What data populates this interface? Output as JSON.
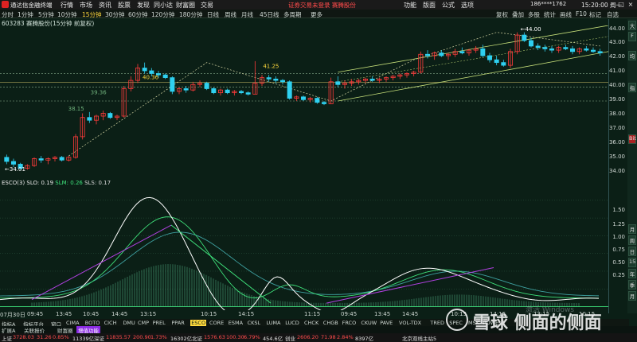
{
  "titlebar": {
    "app_name": "通达信金融终端",
    "menu": [
      "行情",
      "市场",
      "资讯",
      "股票",
      "发现",
      "同小达",
      "财富圈",
      "交易"
    ],
    "notice": "证券交易未登录  赛腾股份",
    "right_menu": [
      "功能",
      "版面",
      "公式",
      "选项"
    ],
    "account": "186****1762",
    "clock": "15:20:00 周一"
  },
  "periodbar": {
    "periods": [
      "分时",
      "1分钟",
      "5分钟",
      "10分钟",
      "15分钟",
      "30分钟",
      "60分钟",
      "120分钟",
      "180分钟",
      "日线",
      "周线",
      "月线",
      "45日线",
      "多周期",
      "更多"
    ],
    "active_period": "15分钟",
    "right_items": [
      "复权",
      "叠加",
      "多股",
      "统计",
      "画线",
      "F10",
      "标记",
      "自选"
    ]
  },
  "stock_label": "603283 赛腾股份(15分钟 前复权)",
  "indicator_label": {
    "main": "ESCO(3) SLO: 0.19",
    "slm": "SLM: 0.26",
    "sls": "SLS: 0.17"
  },
  "price_axis": [
    "44.00",
    "43.00",
    "42.00",
    "41.00",
    "40.00",
    "39.00",
    "38.00",
    "37.00",
    "36.00",
    "35.00",
    "34.00"
  ],
  "lower_axis": [
    "1.50",
    "1.25",
    "1.00",
    "0.75",
    "0.50",
    "0.25"
  ],
  "annotations": {
    "high": "44.00",
    "low": "34.01",
    "level1": "40.36",
    "level2": "41.25",
    "level3": "39.36",
    "level4": "38.15"
  },
  "time_axis": [
    "07月30日",
    "09:45",
    "13:45",
    "10:45",
    "14:45",
    "13:15",
    "10:15",
    "14:15",
    "11:15",
    "09:45",
    "13:45",
    "14:45",
    "10:15",
    "14:15",
    "13:15",
    "10:15"
  ],
  "indicator_tabs": [
    "指标A",
    "指标平台",
    "窗口",
    "CIMA",
    "BOTO",
    "CICH",
    "DMU",
    "CMP",
    "PREL",
    "PPAR",
    "ESCO",
    "CORE",
    "ESMA",
    "CKSL",
    "LUMA",
    "LUCD",
    "CHCK",
    "CHGB",
    "FRCO",
    "CKUW",
    "PAVE",
    "VOL-TDX",
    "TRED",
    "SPEC",
    "MSK",
    "POWE"
  ],
  "active_indicator": "ESCO",
  "sub_tabs": [
    "扩展A",
    "关联报价",
    "财富圈",
    "增值功能"
  ],
  "statusbar": {
    "sh_label": "上证",
    "sh_value": "3728.03",
    "sh_change": "31.26",
    "sh_pct": "0.85%",
    "sh_amount": "11339亿",
    "sz_label": "深证",
    "sz_value": "11835.57",
    "sz_change": "200.90",
    "sz_pct": "1.73%",
    "sz_amount": "16302亿",
    "bz_label": "北证",
    "bz_value": "1576.63",
    "bz_change": "100.30",
    "bz_pct": "6.79%",
    "bz_amount": "454.6亿",
    "cy_label": "创业",
    "cy_value": "2606.20",
    "cy_change": "71.98",
    "cy_pct": "2.84%",
    "cy_amount": "8397亿",
    "site": "北京双线主站5"
  },
  "watermark": {
    "text": "雪球 侧面的侧面",
    "faint": "激活 Windows"
  },
  "right_tools": [
    "大",
    "F",
    "均",
    "指",
    "Bit",
    "月",
    "周",
    "日",
    "15",
    "年",
    "季",
    "月"
  ],
  "colors": {
    "background": "#0b1f16",
    "up": "#ff3b3b",
    "down": "#2fd0f0",
    "accent": "#ffd93d",
    "ma_white": "#ffffff",
    "ma_green": "#3ee07a",
    "ma_purple": "#b040e0"
  },
  "chart_data": {
    "type": "candlestick",
    "ylim": [
      33.5,
      44.5
    ],
    "candles": [
      {
        "o": 34.9,
        "h": 35.1,
        "l": 34.4,
        "c": 34.6
      },
      {
        "o": 34.6,
        "h": 34.8,
        "l": 34.2,
        "c": 34.4
      },
      {
        "o": 34.4,
        "h": 34.5,
        "l": 34.0,
        "c": 34.1
      },
      {
        "o": 34.1,
        "h": 34.4,
        "l": 34.0,
        "c": 34.3
      },
      {
        "o": 34.3,
        "h": 34.9,
        "l": 34.2,
        "c": 34.8
      },
      {
        "o": 34.8,
        "h": 35.0,
        "l": 34.5,
        "c": 34.7
      },
      {
        "o": 34.7,
        "h": 34.9,
        "l": 34.4,
        "c": 34.8
      },
      {
        "o": 34.8,
        "h": 35.0,
        "l": 34.6,
        "c": 34.9
      },
      {
        "o": 34.9,
        "h": 35.0,
        "l": 34.6,
        "c": 34.7
      },
      {
        "o": 34.7,
        "h": 35.0,
        "l": 34.6,
        "c": 34.9
      },
      {
        "o": 34.9,
        "h": 36.6,
        "l": 34.8,
        "c": 36.4
      },
      {
        "o": 36.4,
        "h": 38.1,
        "l": 36.2,
        "c": 37.8
      },
      {
        "o": 37.8,
        "h": 38.2,
        "l": 37.4,
        "c": 37.6
      },
      {
        "o": 37.6,
        "h": 38.0,
        "l": 37.3,
        "c": 37.9
      },
      {
        "o": 37.9,
        "h": 38.3,
        "l": 37.6,
        "c": 38.1
      },
      {
        "o": 38.1,
        "h": 38.2,
        "l": 37.7,
        "c": 37.8
      },
      {
        "o": 37.8,
        "h": 38.0,
        "l": 37.6,
        "c": 37.9
      },
      {
        "o": 37.9,
        "h": 40.1,
        "l": 37.8,
        "c": 39.9
      },
      {
        "o": 39.9,
        "h": 40.8,
        "l": 39.7,
        "c": 40.5
      },
      {
        "o": 40.5,
        "h": 41.7,
        "l": 40.3,
        "c": 41.4
      },
      {
        "o": 41.4,
        "h": 41.8,
        "l": 41.0,
        "c": 41.2
      },
      {
        "o": 41.2,
        "h": 41.4,
        "l": 40.8,
        "c": 41.0
      },
      {
        "o": 41.0,
        "h": 41.2,
        "l": 40.7,
        "c": 40.9
      },
      {
        "o": 40.9,
        "h": 41.0,
        "l": 40.6,
        "c": 40.7
      },
      {
        "o": 40.7,
        "h": 40.8,
        "l": 39.5,
        "c": 39.7
      },
      {
        "o": 39.7,
        "h": 40.0,
        "l": 39.5,
        "c": 39.9
      },
      {
        "o": 39.9,
        "h": 40.1,
        "l": 39.6,
        "c": 39.8
      },
      {
        "o": 39.8,
        "h": 40.4,
        "l": 39.7,
        "c": 40.2
      },
      {
        "o": 40.2,
        "h": 40.5,
        "l": 40.0,
        "c": 40.3
      },
      {
        "o": 40.3,
        "h": 40.4,
        "l": 39.8,
        "c": 39.9
      },
      {
        "o": 39.9,
        "h": 40.0,
        "l": 39.5,
        "c": 39.6
      },
      {
        "o": 39.6,
        "h": 39.9,
        "l": 39.4,
        "c": 39.8
      },
      {
        "o": 39.8,
        "h": 39.9,
        "l": 39.5,
        "c": 39.6
      },
      {
        "o": 39.6,
        "h": 39.8,
        "l": 39.4,
        "c": 39.7
      },
      {
        "o": 39.7,
        "h": 39.8,
        "l": 39.5,
        "c": 39.6
      },
      {
        "o": 39.6,
        "h": 39.7,
        "l": 39.4,
        "c": 39.5
      },
      {
        "o": 39.5,
        "h": 41.9,
        "l": 39.5,
        "c": 40.3
      },
      {
        "o": 40.3,
        "h": 40.9,
        "l": 40.1,
        "c": 40.7
      },
      {
        "o": 40.7,
        "h": 40.9,
        "l": 40.4,
        "c": 40.6
      },
      {
        "o": 40.6,
        "h": 40.8,
        "l": 40.3,
        "c": 40.5
      },
      {
        "o": 40.5,
        "h": 40.6,
        "l": 40.2,
        "c": 40.4
      },
      {
        "o": 40.4,
        "h": 40.5,
        "l": 39.1,
        "c": 39.2
      },
      {
        "o": 39.2,
        "h": 39.4,
        "l": 39.0,
        "c": 39.3
      },
      {
        "o": 39.3,
        "h": 39.4,
        "l": 39.0,
        "c": 39.1
      },
      {
        "o": 39.1,
        "h": 39.3,
        "l": 38.9,
        "c": 39.2
      },
      {
        "o": 39.2,
        "h": 39.3,
        "l": 38.8,
        "c": 38.9
      },
      {
        "o": 38.9,
        "h": 39.0,
        "l": 38.7,
        "c": 38.8
      },
      {
        "o": 38.8,
        "h": 40.7,
        "l": 38.8,
        "c": 40.4
      },
      {
        "o": 40.4,
        "h": 40.8,
        "l": 40.0,
        "c": 40.2
      },
      {
        "o": 40.2,
        "h": 40.5,
        "l": 39.9,
        "c": 40.3
      },
      {
        "o": 40.3,
        "h": 40.6,
        "l": 40.1,
        "c": 40.4
      },
      {
        "o": 40.4,
        "h": 40.6,
        "l": 40.2,
        "c": 40.5
      },
      {
        "o": 40.5,
        "h": 40.7,
        "l": 40.3,
        "c": 40.6
      },
      {
        "o": 40.6,
        "h": 40.8,
        "l": 40.4,
        "c": 40.5
      },
      {
        "o": 40.5,
        "h": 40.7,
        "l": 40.3,
        "c": 40.6
      },
      {
        "o": 40.6,
        "h": 40.8,
        "l": 40.4,
        "c": 40.7
      },
      {
        "o": 40.7,
        "h": 40.9,
        "l": 40.5,
        "c": 40.8
      },
      {
        "o": 40.8,
        "h": 41.0,
        "l": 40.6,
        "c": 40.9
      },
      {
        "o": 40.9,
        "h": 41.1,
        "l": 40.7,
        "c": 41.0
      },
      {
        "o": 41.0,
        "h": 41.2,
        "l": 40.8,
        "c": 41.1
      },
      {
        "o": 41.1,
        "h": 42.6,
        "l": 41.0,
        "c": 42.4
      },
      {
        "o": 42.4,
        "h": 42.7,
        "l": 42.1,
        "c": 42.3
      },
      {
        "o": 42.3,
        "h": 42.6,
        "l": 42.0,
        "c": 42.5
      },
      {
        "o": 42.5,
        "h": 42.7,
        "l": 42.2,
        "c": 42.3
      },
      {
        "o": 42.3,
        "h": 42.5,
        "l": 42.0,
        "c": 42.4
      },
      {
        "o": 42.4,
        "h": 42.8,
        "l": 42.2,
        "c": 42.6
      },
      {
        "o": 42.6,
        "h": 42.9,
        "l": 42.4,
        "c": 42.5
      },
      {
        "o": 42.5,
        "h": 42.8,
        "l": 42.3,
        "c": 42.7
      },
      {
        "o": 42.7,
        "h": 43.0,
        "l": 42.5,
        "c": 42.8
      },
      {
        "o": 42.8,
        "h": 43.1,
        "l": 42.2,
        "c": 42.3
      },
      {
        "o": 42.3,
        "h": 42.5,
        "l": 41.8,
        "c": 42.0
      },
      {
        "o": 42.0,
        "h": 42.3,
        "l": 41.6,
        "c": 41.8
      },
      {
        "o": 41.8,
        "h": 42.0,
        "l": 41.5,
        "c": 41.6
      },
      {
        "o": 41.6,
        "h": 42.8,
        "l": 41.4,
        "c": 42.6
      },
      {
        "o": 42.6,
        "h": 44.0,
        "l": 42.4,
        "c": 43.8
      },
      {
        "o": 43.8,
        "h": 44.0,
        "l": 43.3,
        "c": 43.4
      },
      {
        "o": 43.4,
        "h": 43.6,
        "l": 42.9,
        "c": 43.0
      },
      {
        "o": 43.0,
        "h": 43.2,
        "l": 42.7,
        "c": 42.9
      },
      {
        "o": 42.9,
        "h": 43.1,
        "l": 42.6,
        "c": 42.8
      },
      {
        "o": 42.8,
        "h": 43.0,
        "l": 42.5,
        "c": 42.7
      },
      {
        "o": 42.7,
        "h": 43.0,
        "l": 42.5,
        "c": 42.9
      },
      {
        "o": 42.9,
        "h": 43.1,
        "l": 42.7,
        "c": 42.8
      },
      {
        "o": 42.8,
        "h": 43.0,
        "l": 42.4,
        "c": 42.6
      },
      {
        "o": 42.6,
        "h": 42.9,
        "l": 42.4,
        "c": 42.8
      },
      {
        "o": 42.8,
        "h": 43.0,
        "l": 42.6,
        "c": 42.7
      },
      {
        "o": 42.7,
        "h": 42.9,
        "l": 42.5,
        "c": 42.6
      },
      {
        "o": 42.6,
        "h": 42.8,
        "l": 42.3,
        "c": 42.5
      }
    ]
  }
}
